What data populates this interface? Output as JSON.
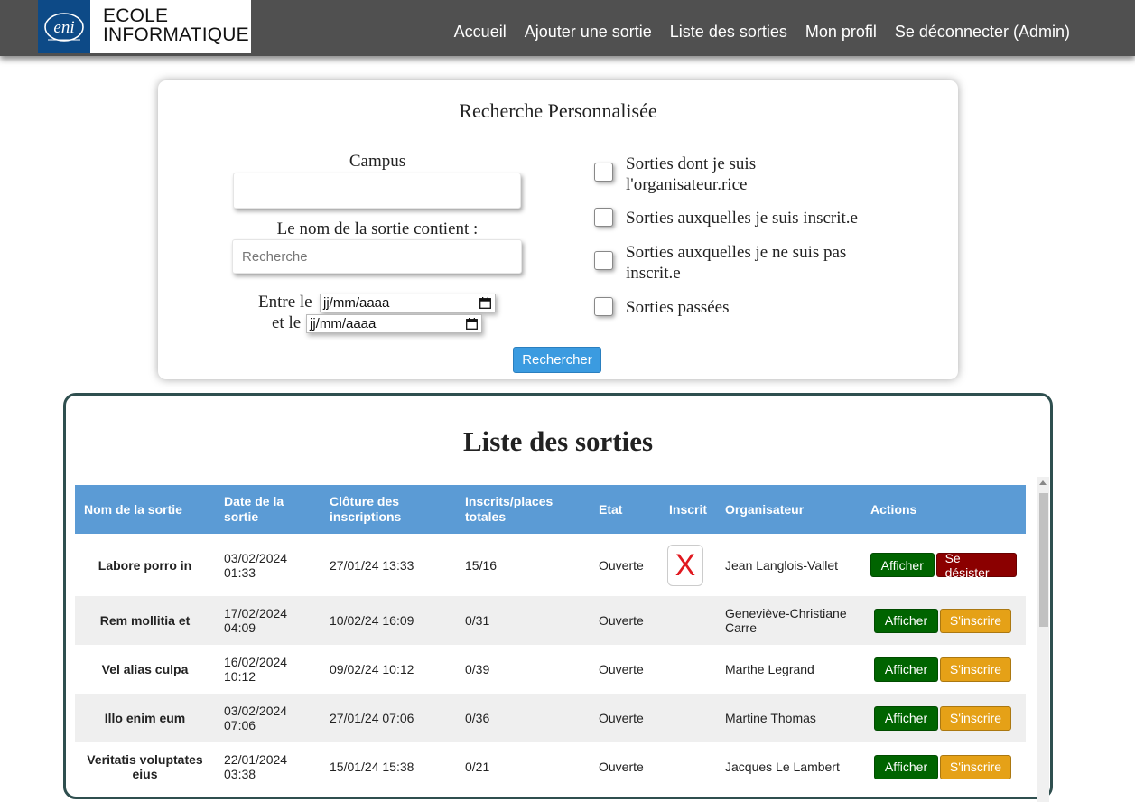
{
  "header": {
    "logo_mark": "eni",
    "logo_line1": "ECOLE",
    "logo_line2": "INFORMATIQUE",
    "nav": [
      "Accueil",
      "Ajouter une sortie",
      "Liste des sorties",
      "Mon profil",
      "Se déconnecter (Admin)"
    ]
  },
  "search": {
    "title": "Recherche Personnalisée",
    "campus_label": "Campus",
    "campus_value": "",
    "name_label": "Le nom de la sortie contient :",
    "name_placeholder": "Recherche",
    "between_label": "Entre le",
    "and_label": "et le",
    "date_placeholder": "jj/mm/aaaa",
    "checkboxes": [
      {
        "label_l1": "Sorties dont je suis",
        "label_l2": "l'organisateur.rice",
        "checked": false
      },
      {
        "label_l1": "Sorties auxquelles je suis inscrit.e",
        "label_l2": "",
        "checked": false
      },
      {
        "label_l1": "Sorties auxquelles je ne suis pas",
        "label_l2": "inscrit.e",
        "checked": false
      },
      {
        "label_l1": "Sorties passées",
        "label_l2": "",
        "checked": false
      }
    ],
    "button": "Rechercher"
  },
  "list": {
    "title": "Liste des sorties",
    "columns": [
      "Nom de la sortie",
      "Date de la sortie",
      "Clôture des inscriptions",
      "Inscrits/places totales",
      "Etat",
      "Inscrit",
      "Organisateur",
      "Actions"
    ],
    "rows": [
      {
        "name": "Labore porro in",
        "date": "03/02/2024 01:33",
        "closing": "27/01/24 13:33",
        "places": "15/16",
        "state": "Ouverte",
        "inscrit": "X",
        "organizer": "Jean Langlois-Vallet",
        "show": "Afficher",
        "action": "Se désister",
        "action_type": "leave"
      },
      {
        "name": "Rem mollitia et",
        "date": "17/02/2024 04:09",
        "closing": "10/02/24 16:09",
        "places": "0/31",
        "state": "Ouverte",
        "inscrit": "",
        "organizer": "Geneviève-Christiane Carre",
        "show": "Afficher",
        "action": "S'inscrire",
        "action_type": "join"
      },
      {
        "name": "Vel alias culpa",
        "date": "16/02/2024 10:12",
        "closing": "09/02/24 10:12",
        "places": "0/39",
        "state": "Ouverte",
        "inscrit": "",
        "organizer": "Marthe Legrand",
        "show": "Afficher",
        "action": "S'inscrire",
        "action_type": "join"
      },
      {
        "name": "Illo enim eum",
        "date": "03/02/2024 07:06",
        "closing": "27/01/24 07:06",
        "places": "0/36",
        "state": "Ouverte",
        "inscrit": "",
        "organizer": "Martine Thomas",
        "show": "Afficher",
        "action": "S'inscrire",
        "action_type": "join"
      },
      {
        "name": "Veritatis voluptates eius",
        "date": "22/01/2024 03:38",
        "closing": "15/01/24 15:38",
        "places": "0/21",
        "state": "Ouverte",
        "inscrit": "",
        "organizer": "Jacques Le Lambert",
        "show": "Afficher",
        "action": "S'inscrire",
        "action_type": "join"
      }
    ]
  }
}
